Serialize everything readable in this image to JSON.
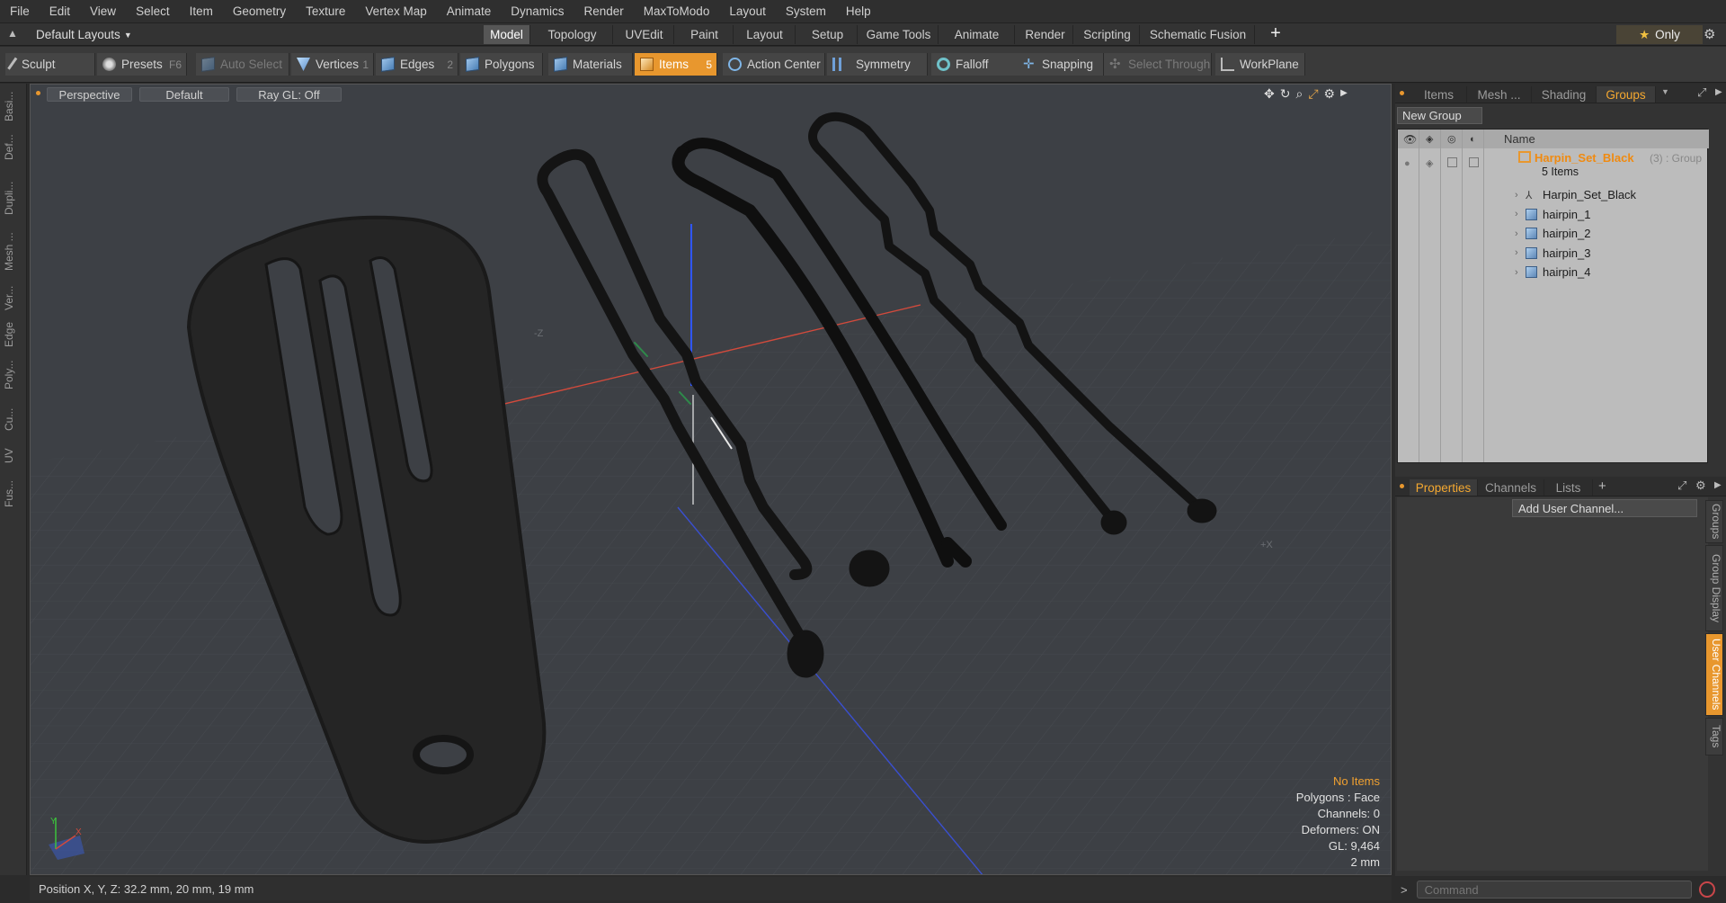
{
  "menu": [
    "File",
    "Edit",
    "View",
    "Select",
    "Item",
    "Geometry",
    "Texture",
    "Vertex Map",
    "Animate",
    "Dynamics",
    "Render",
    "MaxToModo",
    "Layout",
    "System",
    "Help"
  ],
  "layout_bar": {
    "layout_selector": "Default Layouts",
    "tabs": [
      "Model",
      "Topology",
      "UVEdit",
      "Paint",
      "Layout",
      "Setup",
      "Game Tools",
      "Animate",
      "Render",
      "Scripting",
      "Schematic Fusion"
    ],
    "active_tab": "Model",
    "add_icon": "plus-icon",
    "only_label": "Only"
  },
  "toolbar": {
    "sculpt": "Sculpt",
    "presets": "Presets",
    "presets_key": "F6",
    "auto_select": "Auto Select",
    "vertices": "Vertices",
    "vertices_key": "1",
    "edges": "Edges",
    "edges_key": "2",
    "polygons": "Polygons",
    "materials": "Materials",
    "items": "Items",
    "items_key": "5",
    "action_center": "Action Center",
    "symmetry": "Symmetry",
    "falloff": "Falloff",
    "snapping": "Snapping",
    "select_through": "Select Through",
    "workplane": "WorkPlane"
  },
  "left_tabs": [
    "Basi...",
    "Def...",
    "Dupli...",
    "Mesh ...",
    "Ver...",
    "Edge",
    "Poly...",
    "Cu...",
    "UV",
    "Fus..."
  ],
  "viewport": {
    "view_mode": "Perspective",
    "shading": "Default",
    "raygl": "Ray GL: Off",
    "axis_z_label": "-Z",
    "axis_x_label": "+X",
    "info": {
      "selection": "No Items",
      "polygons": "Polygons : Face",
      "channels": "Channels: 0",
      "deformers": "Deformers: ON",
      "gl": "GL: 9,464",
      "scale": "2 mm"
    }
  },
  "status": {
    "position": "Position X, Y, Z:  32.2 mm, 20 mm, 19 mm"
  },
  "right_panel": {
    "top_tabs": [
      "Items",
      "Mesh ...",
      "Shading",
      "Groups"
    ],
    "active_top_tab": "Groups",
    "new_group": "New Group",
    "name_header": "Name",
    "group": {
      "name": "Harpin_Set_Black",
      "suffix": "(3) : Group",
      "count": "5 Items"
    },
    "children": [
      "Harpin_Set_Black",
      "hairpin_1",
      "hairpin_2",
      "hairpin_3",
      "hairpin_4"
    ],
    "bottom_tabs": [
      "Properties",
      "Channels",
      "Lists"
    ],
    "active_bottom_tab": "Properties",
    "add_user_channel": "Add User Channel...",
    "side_tabs": [
      "Groups",
      "Group Display",
      "User Channels",
      "Tags"
    ],
    "active_side_tab": "User Channels"
  },
  "command": {
    "prompt": ">",
    "placeholder": "Command"
  },
  "colors": {
    "accent": "#e8972e",
    "viewport_bg": "#3d4045",
    "x_axis": "#d24a3c",
    "z_axis": "#3a4fd0"
  }
}
